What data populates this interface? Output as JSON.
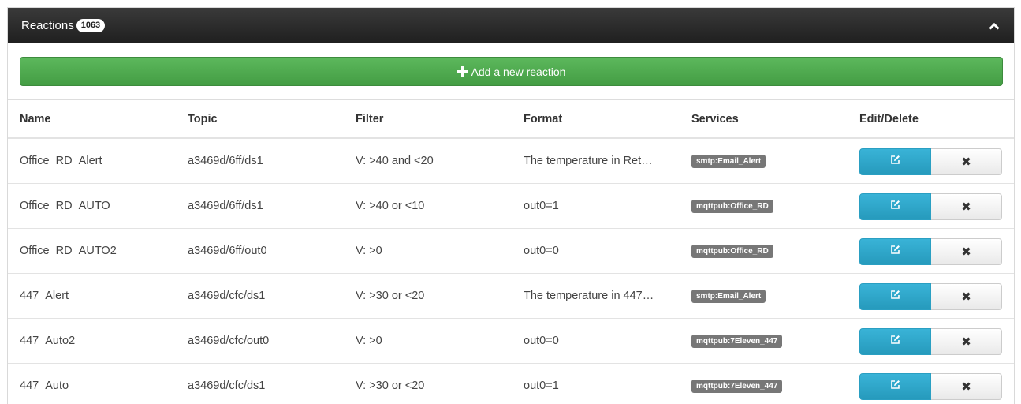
{
  "panel": {
    "title": "Reactions",
    "count": "1063",
    "collapse_icon": "chevron-up-icon",
    "add_button": {
      "icon": "plus-icon",
      "label": "Add a new reaction"
    }
  },
  "table": {
    "headers": [
      "Name",
      "Topic",
      "Filter",
      "Format",
      "Services",
      "Edit/Delete"
    ],
    "rows": [
      {
        "name": "Office_RD_Alert",
        "topic": "a3469d/6ff/ds1",
        "filter": "V: >40 and <20",
        "format": "The temperature in Ret…",
        "service": "smtp:Email_Alert"
      },
      {
        "name": "Office_RD_AUTO",
        "topic": "a3469d/6ff/ds1",
        "filter": "V: >40 or <10",
        "format": "out0=1",
        "service": "mqttpub:Office_RD"
      },
      {
        "name": "Office_RD_AUTO2",
        "topic": "a3469d/6ff/out0",
        "filter": "V: >0",
        "format": "out0=0",
        "service": "mqttpub:Office_RD"
      },
      {
        "name": "447_Alert",
        "topic": "a3469d/cfc/ds1",
        "filter": "V: >30 or <20",
        "format": "The temperature in 447…",
        "service": "smtp:Email_Alert"
      },
      {
        "name": "447_Auto2",
        "topic": "a3469d/cfc/out0",
        "filter": "V: >0",
        "format": "out0=0",
        "service": "mqttpub:7Eleven_447"
      },
      {
        "name": "447_Auto",
        "topic": "a3469d/cfc/ds1",
        "filter": "V: >30 or <20",
        "format": "out0=1",
        "service": "mqttpub:7Eleven_447"
      }
    ],
    "edit_icon": "edit-icon",
    "delete_icon": "close-icon",
    "delete_glyph": "✖"
  }
}
